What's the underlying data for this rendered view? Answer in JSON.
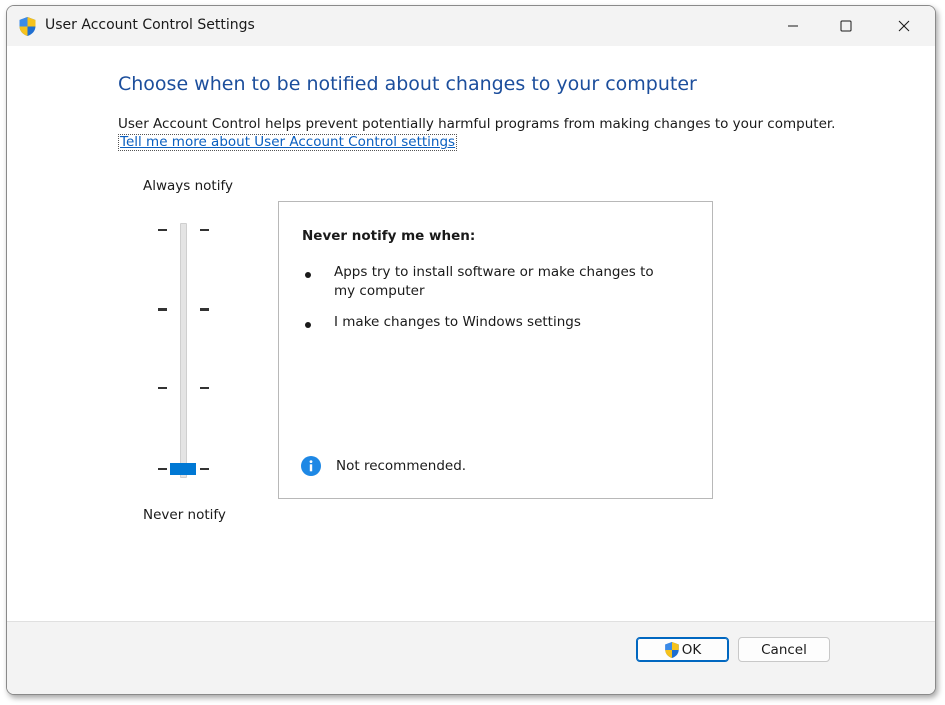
{
  "window": {
    "title": "User Account Control Settings",
    "title_icon": "uac-shield-icon",
    "controls": [
      "minimize-icon",
      "maximize-icon",
      "close-icon"
    ]
  },
  "main": {
    "heading": "Choose when to be notified about changes to your computer",
    "description": "User Account Control helps prevent potentially harmful programs from making changes to your computer.",
    "link": "Tell me more about User Account Control settings"
  },
  "slider": {
    "top_label": "Always notify",
    "bottom_label": "Never notify",
    "levels": 4,
    "selected_level": 1,
    "selected_level_note": "bottom position (1 of 4)"
  },
  "info": {
    "title": "Never notify me when:",
    "bullets": [
      "Apps try to install software or make changes to my computer",
      "I make changes to Windows settings"
    ],
    "note_icon": "info-icon",
    "note": "Not recommended."
  },
  "buttons": {
    "ok": "OK",
    "cancel": "Cancel"
  },
  "colors": {
    "heading": "#1c4e9c",
    "link": "#0a5fc0",
    "accent": "#0078d4",
    "info_icon": "#1e88e5"
  }
}
